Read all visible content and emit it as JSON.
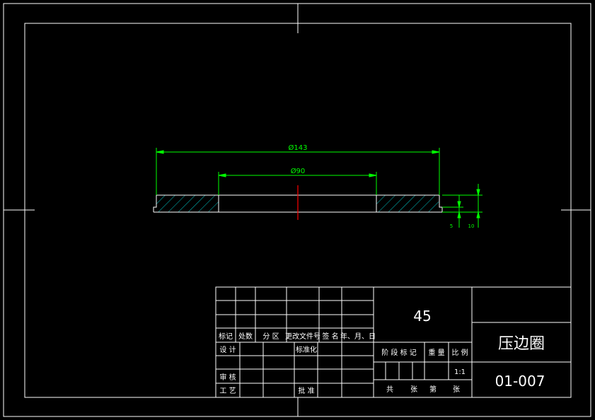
{
  "drawing": {
    "dimensions": {
      "outer_diameter": "Ø143",
      "inner_diameter": "Ø90",
      "side_dim_1": "5",
      "side_dim_2": "10"
    }
  },
  "title_block": {
    "material": "45",
    "part_name": "压边圈",
    "drawing_number": "01-007",
    "scale_value": "1:1",
    "revision_headers": {
      "mark": "标记",
      "count": "处数",
      "zone": "分 区",
      "change_doc": "更改文件号",
      "signature": "签 名",
      "date": "年、月、日"
    },
    "approval_labels": {
      "design": "设 计",
      "standardization": "标准化",
      "review": "审 核",
      "process": "工 艺",
      "approval": "批 准"
    },
    "info_labels": {
      "stage_mark": "阶 段 标 记",
      "weight": "重 量",
      "scale": "比 例"
    },
    "sheet_labels": {
      "total": "共",
      "sheet": "张",
      "page_no": "第",
      "sheet2": "张"
    }
  },
  "colors": {
    "background": "#000000",
    "lines": "#ffffff",
    "dimension": "#00ff00",
    "hatch": "#00c8c8",
    "centerline": "#ff0000"
  }
}
